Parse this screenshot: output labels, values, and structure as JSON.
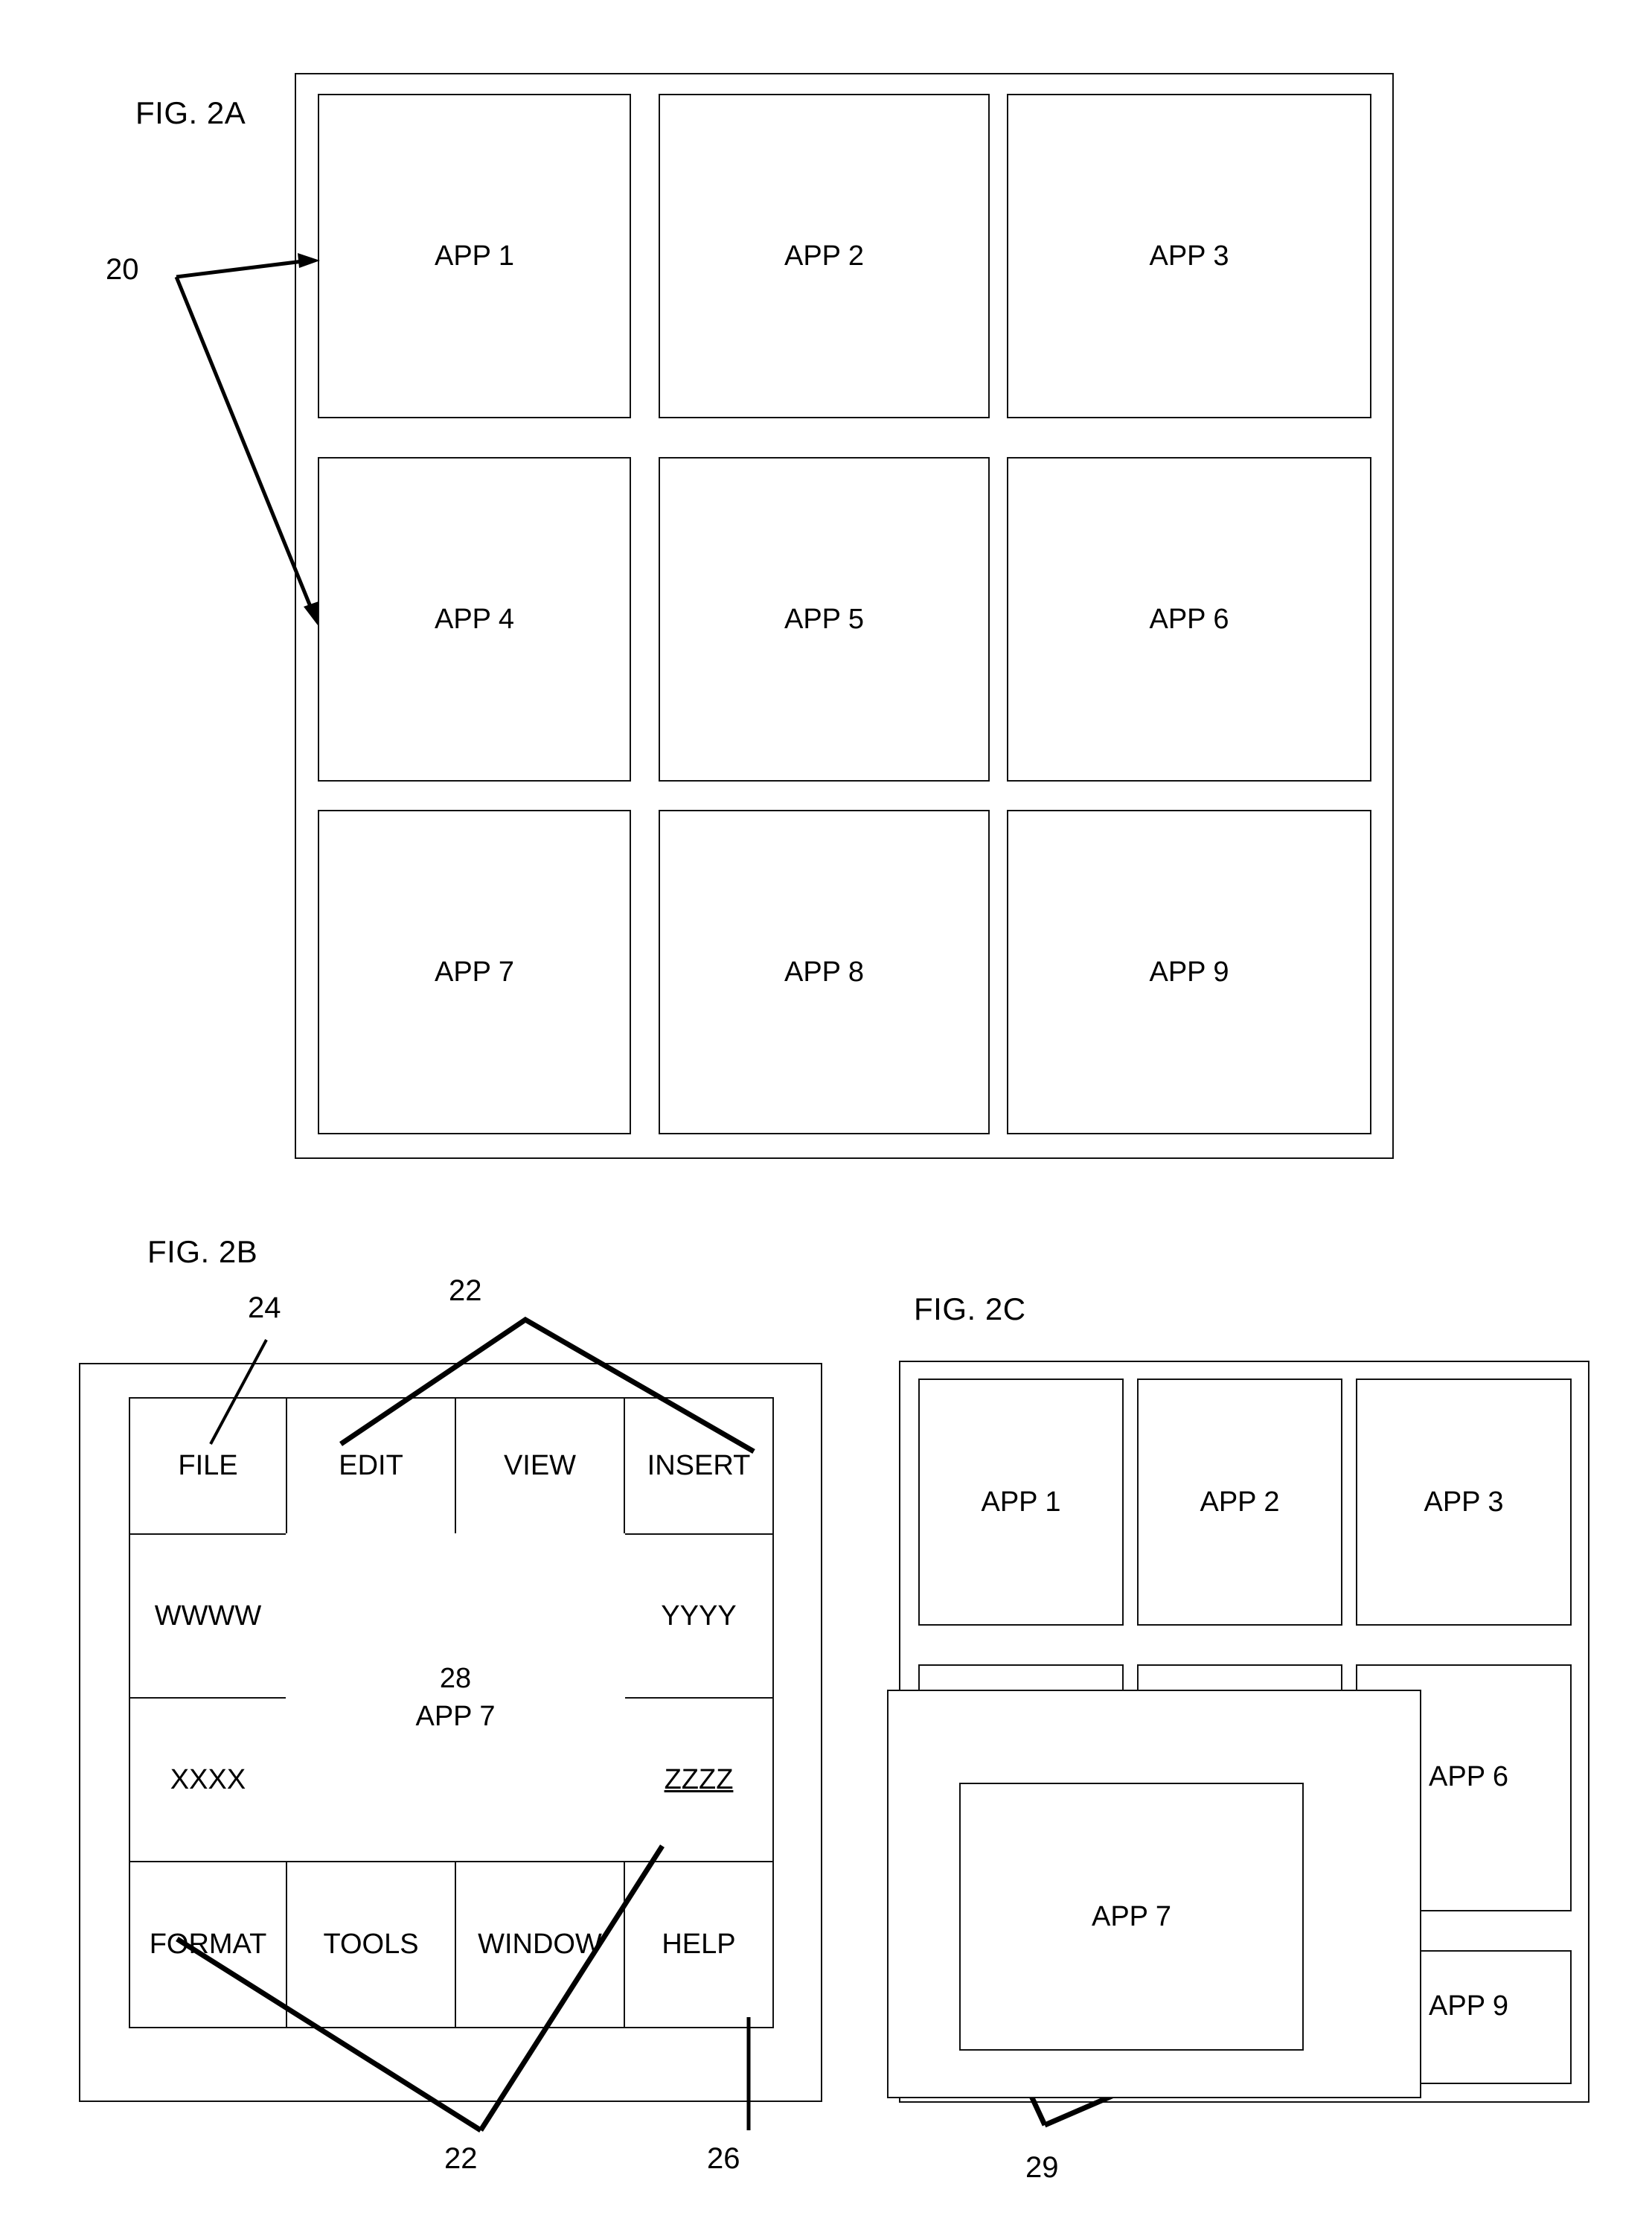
{
  "figures": {
    "fig2a": {
      "caption": "FIG. 2A",
      "ref_20": "20",
      "apps": [
        "APP 1",
        "APP 2",
        "APP 3",
        "APP 4",
        "APP 5",
        "APP 6",
        "APP 7",
        "APP 8",
        "APP 9"
      ]
    },
    "fig2b": {
      "caption": "FIG. 2B",
      "ref_24": "24",
      "ref_22_top": "22",
      "ref_22_bottom": "22",
      "ref_26": "26",
      "ref_28": "28",
      "menu_row_top": [
        "FILE",
        "EDIT",
        "VIEW",
        "INSERT"
      ],
      "menu_left": [
        "WWWW",
        "XXXX"
      ],
      "menu_right": [
        "YYYY",
        "ZZZZ"
      ],
      "menu_row_bottom": [
        "FORMAT",
        "TOOLS",
        "WINDOW",
        "HELP"
      ],
      "center_app": "APP 7"
    },
    "fig2c": {
      "caption": "FIG. 2C",
      "ref_29": "29",
      "apps_row1": [
        "APP 1",
        "APP 2",
        "APP 3"
      ],
      "app6": "APP 6",
      "app9": "APP 9",
      "overlay_app": "APP 7"
    }
  },
  "colors": {
    "ink": "#000000",
    "paper": "#ffffff",
    "line": "#111111"
  }
}
